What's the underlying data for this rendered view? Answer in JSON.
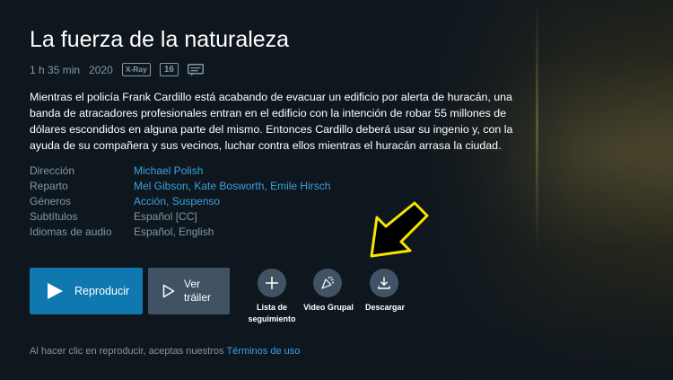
{
  "title": "La fuerza de la naturaleza",
  "meta": {
    "duration": "1 h 35 min",
    "year": "2020",
    "xray": "X-Ray",
    "age_rating": "16",
    "subtitle_icon": "subtitles-icon"
  },
  "synopsis": "Mientras el policía Frank Cardillo está acabando de evacuar un edificio por alerta de huracán, una banda de atracadores profesionales entran en el edificio con la intención de robar 55 millones de dólares escondidos en alguna parte del mismo. Entonces Cardillo deberá usar su ingenio y, con la ayuda de su compañera y sus vecinos, luchar contra ellos mientras el huracán arrasa la ciudad.",
  "details": {
    "director_label": "Dirección",
    "director": "Michael Polish",
    "cast_label": "Reparto",
    "cast_1": "Mel Gibson",
    "cast_2": "Kate Bosworth",
    "cast_3": "Emile Hirsch",
    "genres_label": "Géneros",
    "genre_1": "Acción",
    "genre_2": "Suspenso",
    "subtitles_label": "Subtítulos",
    "subtitles": "Español [CC]",
    "audio_label": "Idiomas de audio",
    "audio": "Español, English"
  },
  "buttons": {
    "play": "Reproducir",
    "trailer_line1": "Ver",
    "trailer_line2": "tráiler",
    "watchlist_line1": "Lista de",
    "watchlist_line2": "seguimiento",
    "watch_party": "Video Grupal",
    "download": "Descargar"
  },
  "footer": {
    "text": "Al hacer clic en reproducir, aceptas nuestros",
    "link": "Términos de uso"
  },
  "colors": {
    "background": "#0f171e",
    "primary_button": "#0f79af",
    "secondary_button": "#425265",
    "link": "#3aa0e0",
    "muted_text": "#8197a4",
    "annotation_arrow": "#f5e600"
  }
}
